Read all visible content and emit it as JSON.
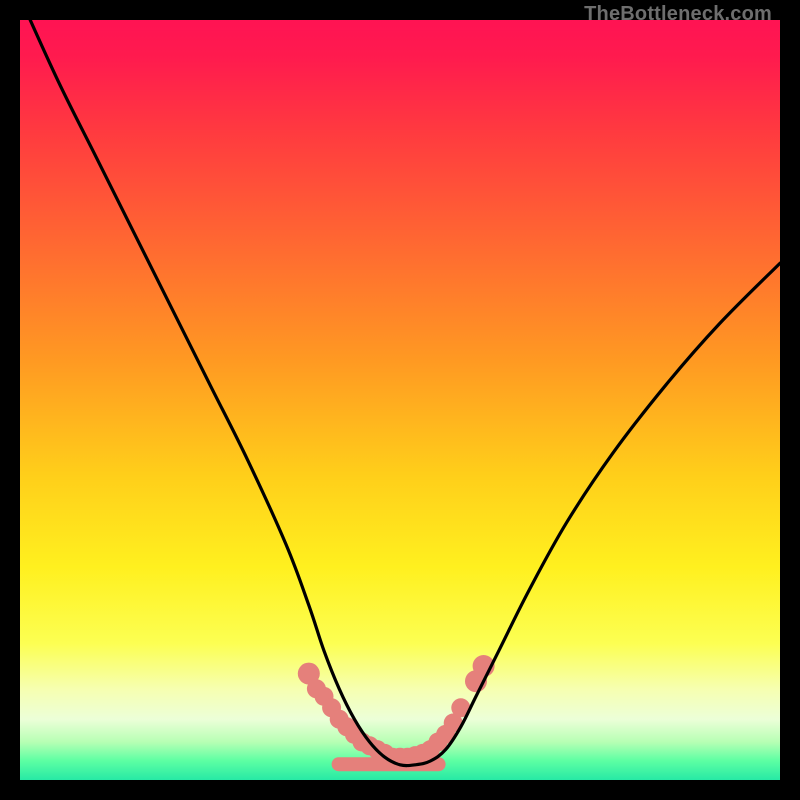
{
  "watermark": "TheBottleneck.com",
  "colors": {
    "frame": "#000000",
    "gradient_stops": [
      {
        "offset": 0.0,
        "color": "#ff1353"
      },
      {
        "offset": 0.05,
        "color": "#ff1b4e"
      },
      {
        "offset": 0.15,
        "color": "#ff3b3f"
      },
      {
        "offset": 0.3,
        "color": "#ff6a31"
      },
      {
        "offset": 0.45,
        "color": "#ff9a22"
      },
      {
        "offset": 0.6,
        "color": "#ffcf1a"
      },
      {
        "offset": 0.72,
        "color": "#fff01f"
      },
      {
        "offset": 0.82,
        "color": "#fcff52"
      },
      {
        "offset": 0.88,
        "color": "#f6ffb0"
      },
      {
        "offset": 0.92,
        "color": "#ecffd8"
      },
      {
        "offset": 0.95,
        "color": "#b7ffb4"
      },
      {
        "offset": 0.975,
        "color": "#5cffa3"
      },
      {
        "offset": 1.0,
        "color": "#27e9a5"
      }
    ],
    "curve": "#000000",
    "marker": "#e5807b"
  },
  "chart_data": {
    "type": "line",
    "title": "",
    "xlabel": "",
    "ylabel": "",
    "xlim": [
      0,
      100
    ],
    "ylim": [
      0,
      100
    ],
    "series": [
      {
        "name": "bottleneck-curve",
        "x": [
          0,
          5,
          10,
          15,
          20,
          25,
          30,
          35,
          38,
          40,
          42,
          44,
          46,
          48,
          50,
          52,
          54,
          56,
          58,
          60,
          63,
          67,
          72,
          78,
          85,
          92,
          100
        ],
        "y": [
          103,
          92,
          82,
          72,
          62,
          52,
          42,
          31,
          23,
          17,
          12,
          8,
          5,
          3,
          2,
          2,
          2.5,
          4,
          7,
          11,
          17,
          25,
          34,
          43,
          52,
          60,
          68
        ]
      }
    ],
    "markers": {
      "name": "highlight-band",
      "x": [
        38,
        39,
        40,
        41,
        42,
        43,
        44,
        45,
        46,
        47,
        48,
        49,
        50,
        51,
        52,
        53,
        54,
        55,
        56,
        57,
        58,
        60,
        61
      ],
      "y": [
        14,
        12,
        11,
        9.5,
        8,
        7,
        6,
        5,
        4.5,
        4,
        3.5,
        3,
        3,
        3,
        3.2,
        3.5,
        4,
        5,
        6,
        7.5,
        9.5,
        13,
        15
      ]
    }
  }
}
